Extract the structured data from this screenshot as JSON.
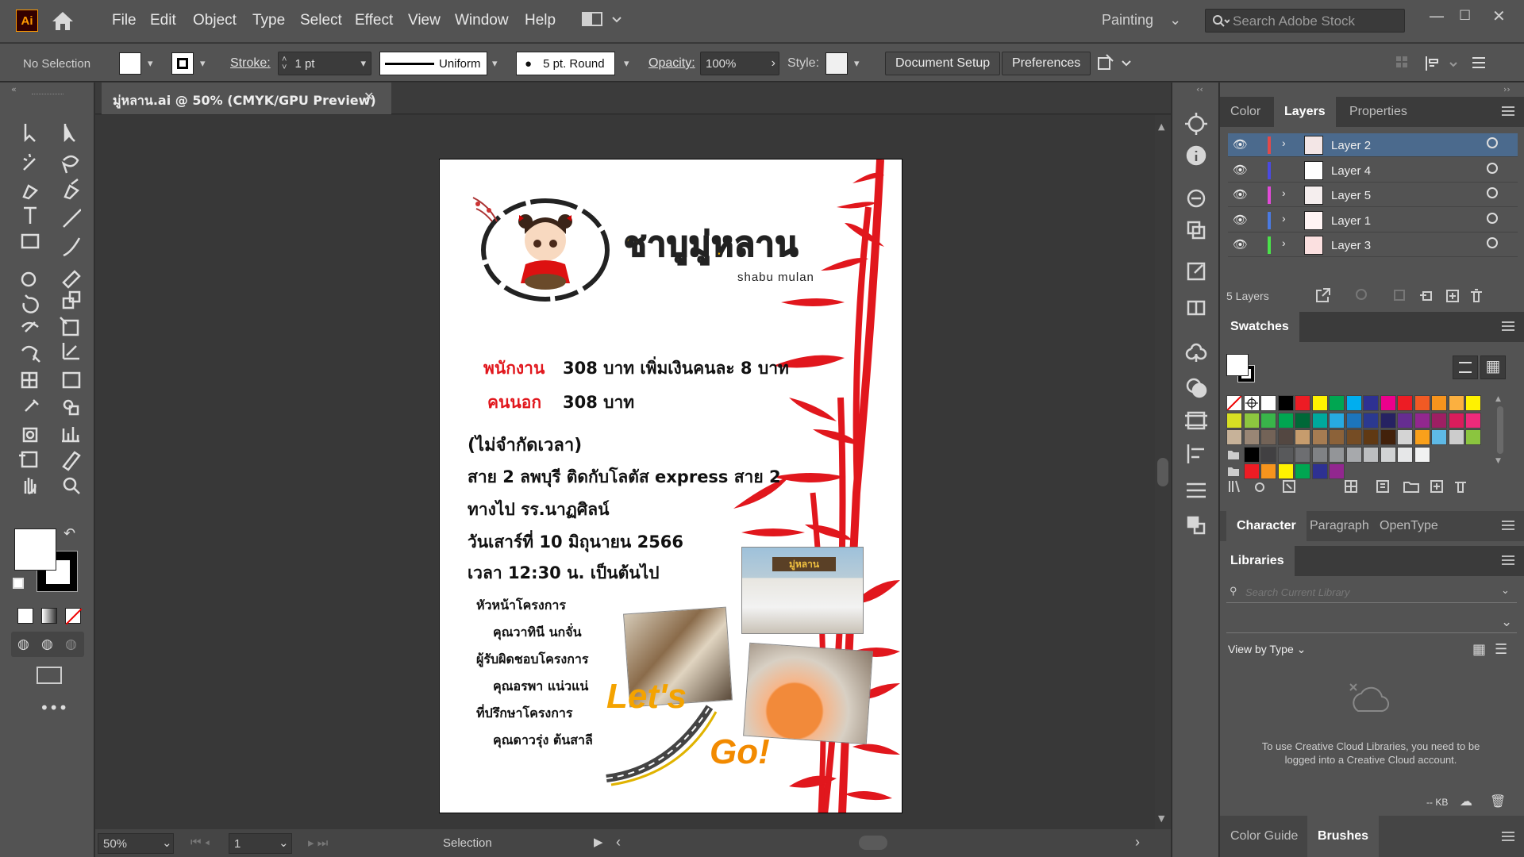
{
  "app": {
    "logo": "Ai",
    "workspace": "Painting",
    "search_placeholder": "Search Adobe Stock"
  },
  "menu": [
    "File",
    "Edit",
    "Object",
    "Type",
    "Select",
    "Effect",
    "View",
    "Window",
    "Help"
  ],
  "control_bar": {
    "selection": "No Selection",
    "stroke_label": "Stroke:",
    "stroke_value": "1 pt",
    "profile": "Uniform",
    "brush": "5 pt. Round",
    "opacity_label": "Opacity:",
    "opacity_value": "100%",
    "style_label": "Style:",
    "document_setup": "Document Setup",
    "preferences": "Preferences"
  },
  "document": {
    "tab_title": "มู่หลาน.ai @ 50% (CMYK/GPU Preview)",
    "zoom": "50%",
    "artboard_num": "1",
    "status_tool": "Selection"
  },
  "poster": {
    "logo_thai": "ชาบูมู่หลาน",
    "logo_en": "shabu mulan",
    "line1_label": "พนักงาน",
    "line1_text": "308 บาท  เพิ่มเงินคนละ 8 บาท",
    "line2_label": "คนนอก",
    "line2_text": "308 บาท",
    "l3": "(ไม่จำกัดเวลา)",
    "l4": "สาย 2 ลพบุรี ติดกับโลตัส express สาย 2",
    "l5": "ทางไป รร.นาฏศิลน์",
    "l6": "วันเสาร์ที่ 10 มิถุนายน 2566",
    "l7": "เวลา 12:30 น. เป็นต้นไป",
    "c1": "หัวหน้าโครงการ",
    "c2": "คุณวาทินี นกจั่น",
    "c3": "ผู้รับผิดชอบโครงการ",
    "c4": "คุณอรพา แน่วแน่",
    "c5": "ที่ปรึกษาโครงการ",
    "c6": "คุณดาวรุ่ง ต้นสาลี",
    "lets": "Let's",
    "go": "Go!",
    "sign": "มู่หลาน"
  },
  "layers_panel": {
    "tabs": [
      "Color",
      "Layers",
      "Properties"
    ],
    "active_tab": "Layers",
    "layers": [
      "Layer 2",
      "Layer 4",
      "Layer 5",
      "Layer 1",
      "Layer 3"
    ],
    "layer_colors": [
      "#e24a4a",
      "#4a4ae2",
      "#e24ad8",
      "#4a7ae2",
      "#4ae24a"
    ],
    "count": "5 Layers"
  },
  "swatches": {
    "title": "Swatches",
    "rows": [
      [
        "none",
        "reg",
        "#ffffff",
        "#000000",
        "#ed1c24",
        "#fff200",
        "#00a651",
        "#00aeef",
        "#2e3192",
        "#ec008c",
        "#ed1c24",
        "#f15a24",
        "#f7941d",
        "#fbb040",
        "#fff200"
      ],
      [
        "#d7df23",
        "#8dc63f",
        "#39b54a",
        "#00a651",
        "#006838",
        "#00a99d",
        "#27aae1",
        "#1c75bc",
        "#2b3990",
        "#262262",
        "#662d91",
        "#92278f",
        "#9e1f63",
        "#da1c5c",
        "#ee2a7b"
      ],
      [
        "#c7b299",
        "#998675",
        "#736357",
        "#534741",
        "#c69c6d",
        "#a67c52",
        "#8c6239",
        "#754c24",
        "#603913",
        "#42210b",
        "#d4d4d4",
        "#f9a01b",
        "#5eb9e6",
        "#cccccc",
        "#8bc53f"
      ],
      [
        "folder",
        "#000000",
        "#414042",
        "#58595b",
        "#6d6e71",
        "#808285",
        "#939598",
        "#a7a9ac",
        "#bcbec0",
        "#d1d3d4",
        "#e6e7e8",
        "#f1f2f2"
      ],
      [
        "folder",
        "#ed1c24",
        "#f7941d",
        "#fff200",
        "#00a651",
        "#2e3192",
        "#92278f"
      ]
    ]
  },
  "char_tabs": [
    "Character",
    "Paragraph",
    "OpenType"
  ],
  "libraries": {
    "title": "Libraries",
    "search_placeholder": "Search Current Library",
    "view_by": "View by Type",
    "message": "To use Creative Cloud Libraries, you need to be logged into a Creative Cloud account.",
    "kb": "-- KB"
  },
  "bottom_tabs": [
    "Color Guide",
    "Brushes"
  ]
}
